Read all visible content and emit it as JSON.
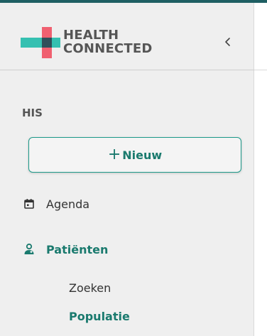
{
  "brand": {
    "line1": "HEALTH",
    "line2": "CONNECTED",
    "colors": {
      "teal": "#35c0b1",
      "coral": "#f06070",
      "overlap": "#2f4f5a"
    }
  },
  "sidebar": {
    "collapse_icon": "chevron-left-icon",
    "section_title": "HIS",
    "new_button": {
      "plus": "+",
      "label": "Nieuw"
    },
    "items": [
      {
        "label": "Agenda",
        "icon": "calendar-icon",
        "active": false
      },
      {
        "label": "Patiënten",
        "icon": "patient-icon",
        "active": true
      }
    ],
    "sub_items": [
      {
        "label": "Zoeken",
        "active": false
      },
      {
        "label": "Populatie",
        "active": true
      }
    ]
  },
  "colors": {
    "accent": "#1a7a6e",
    "accent_border": "#1e9a8a",
    "topbar": "#1f5f63",
    "sidebar_bg": "#efefef",
    "text": "#333333"
  }
}
